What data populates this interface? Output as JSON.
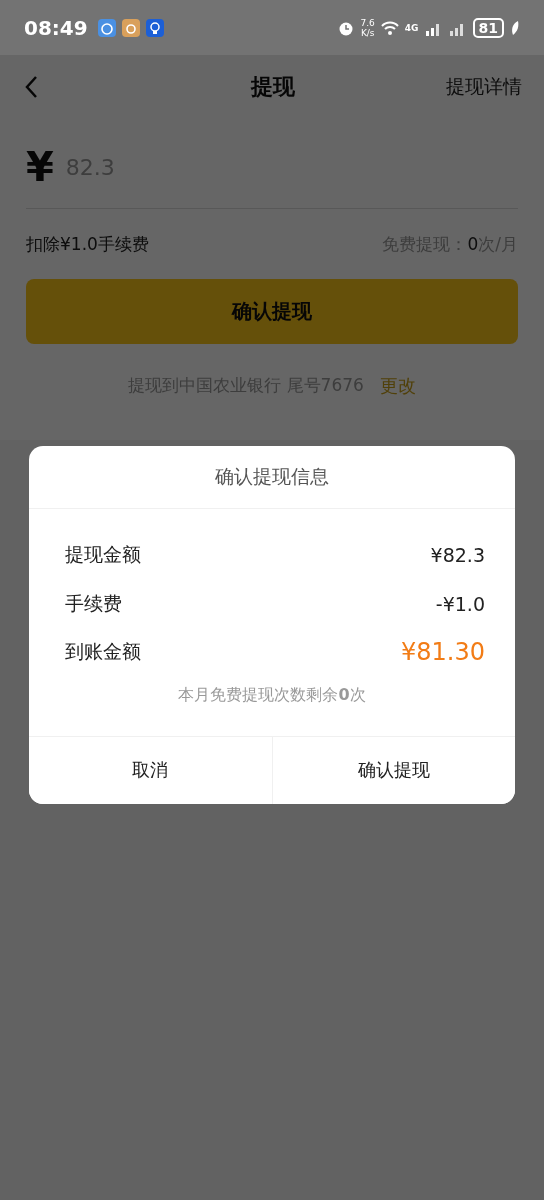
{
  "status_bar": {
    "time": "08:49",
    "speed_value": "7.6",
    "speed_unit": "K/s",
    "network": "4G",
    "battery": "81"
  },
  "nav": {
    "title": "提现",
    "action": "提现详情"
  },
  "amount": {
    "currency": "¥",
    "value": "82.3"
  },
  "fee_note": "扣除¥1.0手续费",
  "free_quota": {
    "label": "免费提现：",
    "count": "0",
    "unit": "次/月"
  },
  "confirm_button": "确认提现",
  "bank": {
    "text": "提现到中国农业银行 尾号7676",
    "change": "更改"
  },
  "dialog": {
    "title": "确认提现信息",
    "rows": [
      {
        "label": "提现金额",
        "value": "¥82.3",
        "highlight": false
      },
      {
        "label": "手续费",
        "value": "-¥1.0",
        "highlight": false
      },
      {
        "label": "到账金额",
        "value": "¥81.30",
        "highlight": true
      }
    ],
    "note": "本月免费提现次数剩余**0**次",
    "buttons": [
      "取消",
      "确认提现"
    ]
  }
}
